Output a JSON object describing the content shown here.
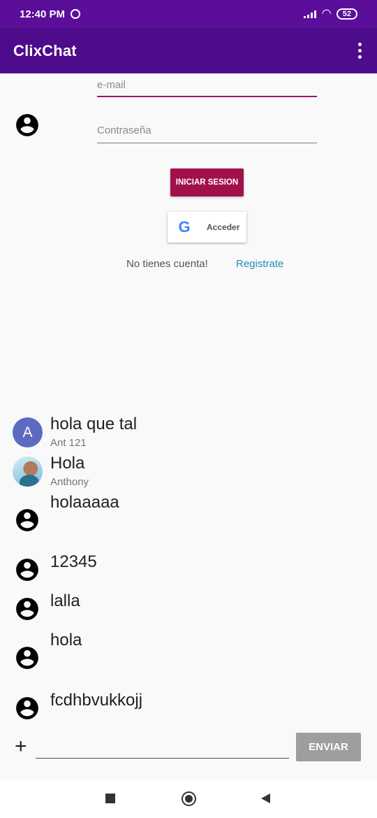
{
  "status_bar": {
    "time": "12:40 PM",
    "battery": "52"
  },
  "app_bar": {
    "title": "ClixChat"
  },
  "login": {
    "email_placeholder": "e-mail",
    "password_placeholder": "Contraseña",
    "login_button": "INICIAR SESION",
    "google_button": "Acceder",
    "no_account_text": "No tienes cuenta!",
    "register_link": "Registrate"
  },
  "messages": [
    {
      "text": "hola que tal",
      "sender": "Ant 121",
      "avatar": "letter",
      "avatar_letter": "A"
    },
    {
      "text": "Hola",
      "sender": "Anthony",
      "avatar": "photo"
    },
    {
      "text": "holaaaaa",
      "sender": "",
      "avatar": "account-circle-icon"
    },
    {
      "text": "12345",
      "sender": "",
      "avatar": "account-circle-icon"
    },
    {
      "text": "lalla",
      "sender": "",
      "avatar": "account-circle-icon"
    },
    {
      "text": "hola",
      "sender": "",
      "avatar": "account-circle-icon"
    },
    {
      "text": "fcdhbvukkojj",
      "sender": "",
      "avatar": "account-circle-icon"
    }
  ],
  "composer": {
    "add_icon": "+",
    "input_value": "",
    "send_button": "ENVIAR"
  },
  "colors": {
    "status_bar": "#5b0e9a",
    "app_bar": "#4e0b8c",
    "accent": "#a1104d",
    "link": "#1f8fb3",
    "letter_avatar": "#5c6bc0",
    "send_button": "#9e9e9e"
  }
}
